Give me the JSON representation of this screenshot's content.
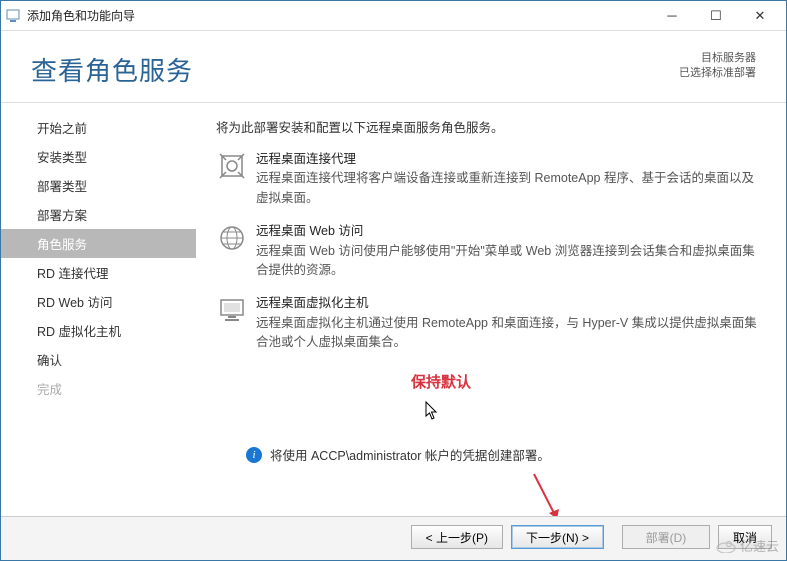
{
  "window": {
    "title": "添加角色和功能向导"
  },
  "header": {
    "page_title": "查看角色服务",
    "dest_label": "目标服务器",
    "dest_value": "已选择标准部署"
  },
  "nav": {
    "items": [
      {
        "label": "开始之前"
      },
      {
        "label": "安装类型"
      },
      {
        "label": "部署类型"
      },
      {
        "label": "部署方案"
      },
      {
        "label": "角色服务"
      },
      {
        "label": "RD 连接代理"
      },
      {
        "label": "RD Web 访问"
      },
      {
        "label": "RD 虚拟化主机"
      },
      {
        "label": "确认"
      },
      {
        "label": "完成"
      }
    ]
  },
  "content": {
    "intro": "将为此部署安装和配置以下远程桌面服务角色服务。",
    "services": [
      {
        "icon": "connection-broker-icon",
        "title": "远程桌面连接代理",
        "desc": "远程桌面连接代理将客户端设备连接或重新连接到 RemoteApp 程序、基于会话的桌面以及虚拟桌面。"
      },
      {
        "icon": "web-access-icon",
        "title": "远程桌面 Web 访问",
        "desc": "远程桌面 Web 访问使用户能够使用\"开始\"菜单或 Web 浏览器连接到会话集合和虚拟桌面集合提供的资源。"
      },
      {
        "icon": "virtualization-host-icon",
        "title": "远程桌面虚拟化主机",
        "desc": "远程桌面虚拟化主机通过使用 RemoteApp 和桌面连接，与 Hyper-V 集成以提供虚拟桌面集合池或个人虚拟桌面集合。"
      }
    ],
    "annotation": "保持默认",
    "info": "将使用 ACCP\\administrator 帐户的凭据创建部署。"
  },
  "buttons": {
    "prev": "< 上一步(P)",
    "next": "下一步(N) >",
    "deploy": "部署(D)",
    "cancel": "取消"
  },
  "watermark": "亿速云"
}
